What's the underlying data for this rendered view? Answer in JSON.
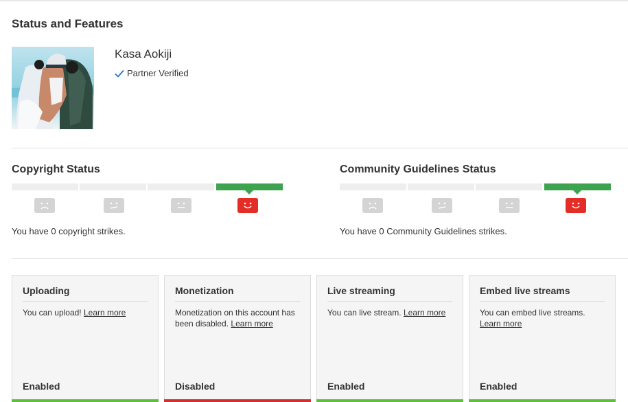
{
  "page": {
    "title": "Status and Features"
  },
  "channel": {
    "name": "Kasa Aokiji",
    "verified_label": "Partner Verified"
  },
  "colors": {
    "accent_green": "#3ea34e",
    "strike_red": "#e52d27",
    "enabled_green": "#5ebf3c",
    "disabled_red": "#d32f2f",
    "verified_blue": "#1e73d2"
  },
  "copyright": {
    "title": "Copyright Status",
    "strikes": 0,
    "message": "You have 0 copyright strikes."
  },
  "community": {
    "title": "Community Guidelines Status",
    "strikes": 0,
    "message": "You have 0 Community Guidelines strikes."
  },
  "features": [
    {
      "title": "Uploading",
      "desc": "You can upload!",
      "link": "Learn more",
      "state": "Enabled"
    },
    {
      "title": "Monetization",
      "desc": "Monetization on this account has been disabled.",
      "link": "Learn more",
      "state": "Disabled"
    },
    {
      "title": "Live streaming",
      "desc": "You can live stream.",
      "link": "Learn more",
      "state": "Enabled"
    },
    {
      "title": "Embed live streams",
      "desc": "You can embed live streams.",
      "link": "Learn more",
      "state": "Enabled"
    }
  ]
}
